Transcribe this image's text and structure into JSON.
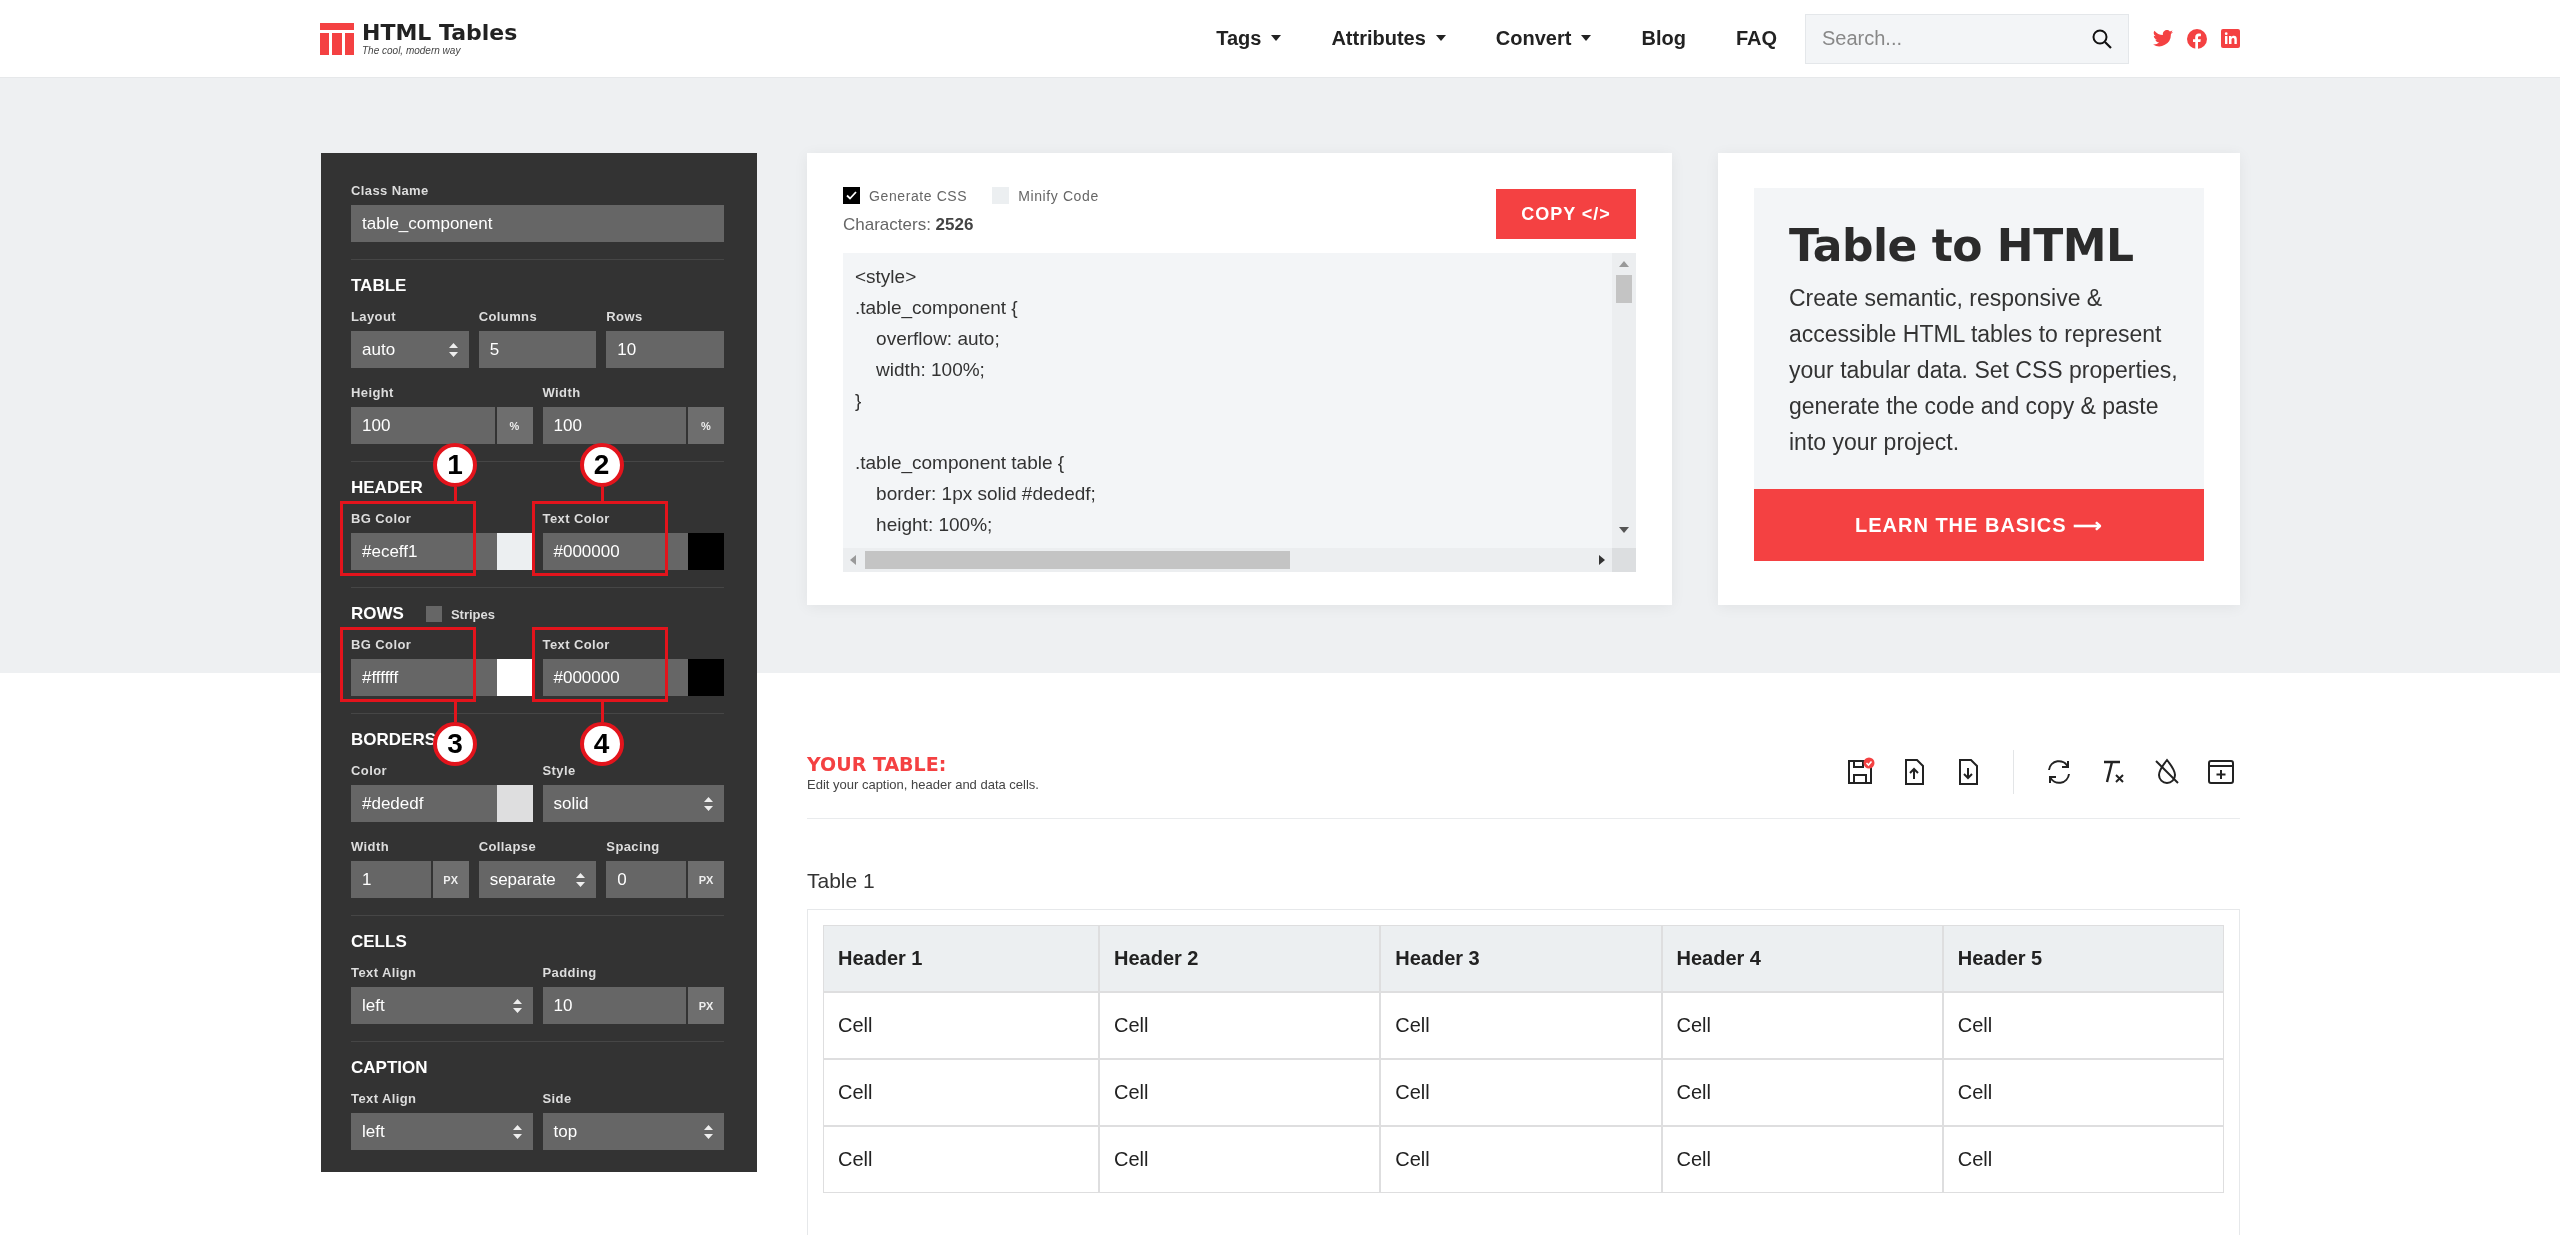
{
  "header": {
    "logo": {
      "name": "HTML Tables",
      "tagline": "The cool, modern way"
    },
    "nav": [
      {
        "label": "Tags",
        "dropdown": true
      },
      {
        "label": "Attributes",
        "dropdown": true
      },
      {
        "label": "Convert",
        "dropdown": true
      },
      {
        "label": "Blog",
        "dropdown": false
      },
      {
        "label": "FAQ",
        "dropdown": false
      }
    ],
    "search": {
      "placeholder": "Search..."
    }
  },
  "settings_panel": {
    "class_name": {
      "label": "Class Name",
      "value": "table_component"
    },
    "sections": [
      {
        "title": "TABLE",
        "field_groups": [
          {
            "fields": [
              {
                "label": "Layout",
                "kind": "select",
                "value": "auto"
              },
              {
                "label": "Columns",
                "kind": "text",
                "value": "5"
              },
              {
                "label": "Rows",
                "kind": "text",
                "value": "10"
              }
            ]
          },
          {
            "fields": [
              {
                "label": "Height",
                "kind": "unit",
                "value": "100",
                "unit": "%"
              },
              {
                "label": "Width",
                "kind": "unit",
                "value": "100",
                "unit": "%"
              }
            ]
          }
        ]
      },
      {
        "title": "HEADER",
        "field_groups": [
          {
            "fields": [
              {
                "label": "BG Color",
                "kind": "color",
                "value": "#eceff1",
                "color": "#eceff1",
                "annotation": {
                  "number": "1",
                  "above": true
                }
              },
              {
                "label": "Text Color",
                "kind": "color",
                "value": "#000000",
                "color": "#000000",
                "annotation": {
                  "number": "2",
                  "above": true
                }
              }
            ]
          }
        ]
      },
      {
        "title": "ROWS",
        "toggle": {
          "label": "Stripes",
          "checked": false
        },
        "field_groups": [
          {
            "fields": [
              {
                "label": "BG Color",
                "kind": "color",
                "value": "#ffffff",
                "color": "#ffffff",
                "annotation": {
                  "number": "3",
                  "above": false
                }
              },
              {
                "label": "Text Color",
                "kind": "color",
                "value": "#000000",
                "color": "#000000",
                "annotation": {
                  "number": "4",
                  "above": false
                }
              }
            ]
          }
        ]
      },
      {
        "title": "BORDERS",
        "field_groups": [
          {
            "fields": [
              {
                "label": "Color",
                "kind": "color",
                "value": "#dededf",
                "color": "#dededf"
              },
              {
                "label": "Style",
                "kind": "select",
                "value": "solid"
              }
            ]
          },
          {
            "fields": [
              {
                "label": "Width",
                "kind": "unit",
                "value": "1",
                "unit": "PX"
              },
              {
                "label": "Collapse",
                "kind": "select",
                "value": "separate"
              },
              {
                "label": "Spacing",
                "kind": "unit",
                "value": "0",
                "unit": "PX"
              }
            ]
          }
        ]
      },
      {
        "title": "CELLS",
        "field_groups": [
          {
            "fields": [
              {
                "label": "Text Align",
                "kind": "select",
                "value": "left"
              },
              {
                "label": "Padding",
                "kind": "unit",
                "value": "10",
                "unit": "PX"
              }
            ]
          }
        ]
      },
      {
        "title": "CAPTION",
        "field_groups": [
          {
            "fields": [
              {
                "label": "Text Align",
                "kind": "select",
                "value": "left"
              },
              {
                "label": "Side",
                "kind": "select",
                "value": "top"
              }
            ]
          }
        ]
      }
    ]
  },
  "code_card": {
    "options": [
      {
        "label": "Generate CSS",
        "checked": true
      },
      {
        "label": "Minify Code",
        "checked": false
      }
    ],
    "characters": "Characters: **2526**",
    "copy_button": "COPY </>",
    "code_blocks": [
      [
        "<style>",
        ".table_component {",
        "    overflow: auto;",
        "    width: 100%;",
        "}"
      ],
      [
        ".table_component table {",
        "    border: 1px solid #dededf;",
        "    height: 100%;"
      ]
    ]
  },
  "intro_card": {
    "title": "Table to HTML",
    "text": "Create semantic, responsive & accessible HTML tables to represent your tabular data. Set CSS properties, generate the code and copy & paste into your project.",
    "button": "LEARN THE BASICS ⟶"
  },
  "table_editor": {
    "title": "YOUR TABLE:",
    "subtitle": "Edit your caption, header and data cells.",
    "caption": "Table 1",
    "columns": [
      "Header 1",
      "Header 2",
      "Header 3",
      "Header 4",
      "Header 5"
    ],
    "rows": [
      [
        "Cell",
        "Cell",
        "Cell",
        "Cell",
        "Cell"
      ],
      [
        "Cell",
        "Cell",
        "Cell",
        "Cell",
        "Cell"
      ],
      [
        "Cell",
        "Cell",
        "Cell",
        "Cell",
        "Cell"
      ]
    ]
  }
}
